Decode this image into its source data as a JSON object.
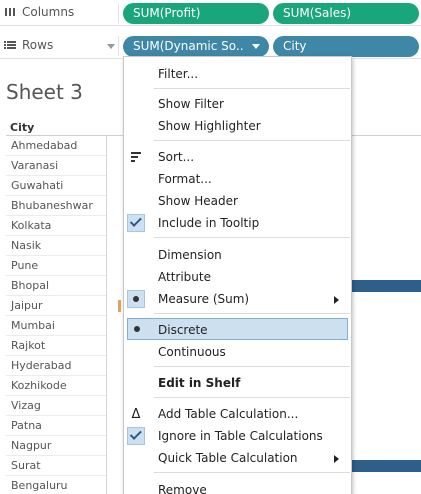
{
  "shelves": {
    "columns": {
      "label": "Columns",
      "pills": [
        "SUM(Profit)",
        "SUM(Sales)"
      ]
    },
    "rows": {
      "label": "Rows",
      "pills": [
        "SUM(Dynamic So..",
        "City"
      ]
    }
  },
  "sheet": {
    "title": "Sheet 3",
    "column_header": "City",
    "cities": [
      "Ahmedabad",
      "Varanasi",
      "Guwahati",
      "Bhubaneshwar",
      "Kolkata",
      "Nasik",
      "Pune",
      "Bhopal",
      "Jaipur",
      "Mumbai",
      "Rajkot",
      "Hyderabad",
      "Kozhikode",
      "Vizag",
      "Patna",
      "Nagpur",
      "Surat",
      "Bengaluru"
    ]
  },
  "context_menu": {
    "items": {
      "filter": "Filter...",
      "show_filter": "Show Filter",
      "show_highlighter": "Show Highlighter",
      "sort": "Sort...",
      "format": "Format...",
      "show_header": "Show Header",
      "include_in_tooltip": "Include in Tooltip",
      "dimension": "Dimension",
      "attribute": "Attribute",
      "measure": "Measure (Sum)",
      "discrete": "Discrete",
      "continuous": "Continuous",
      "edit_in_shelf": "Edit in Shelf",
      "add_table_calc": "Add Table Calculation...",
      "ignore_in_table_calc": "Ignore in Table Calculations",
      "quick_table_calc": "Quick Table Calculation",
      "remove": "Remove"
    }
  },
  "colors": {
    "green_pill": "#1aa67b",
    "blue_pill": "#3f87a6",
    "bar": "#2d5f8a",
    "highlight": "#cde0f0"
  }
}
